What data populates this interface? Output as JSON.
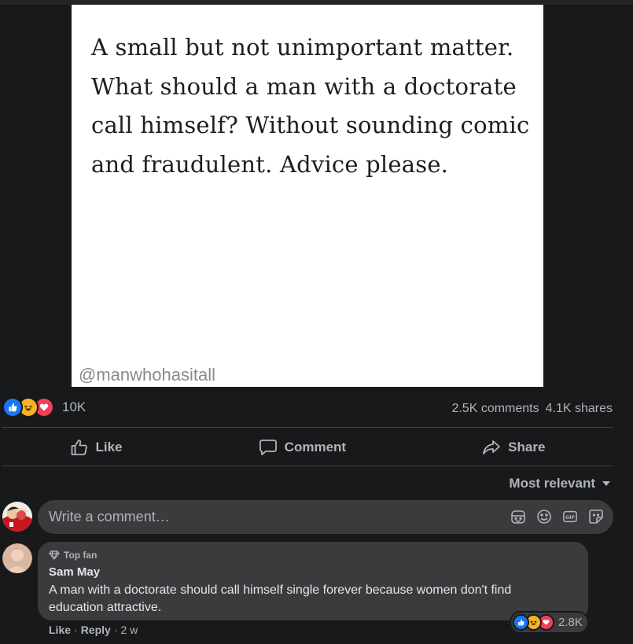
{
  "post": {
    "image_text": "A small but not unimportant matter. What should a man with a doctorate call himself? Without sounding comic and fraudulent. Advice please.",
    "watermark": "@manwhohasitall"
  },
  "reactions": {
    "types": [
      "like-icon",
      "haha-icon",
      "love-icon"
    ],
    "count": "10K"
  },
  "stats": {
    "comments": "2.5K comments",
    "shares": "4.1K shares"
  },
  "actions": {
    "like": "Like",
    "comment": "Comment",
    "share": "Share"
  },
  "sort": {
    "label": "Most relevant"
  },
  "composer": {
    "placeholder": "Write a comment…",
    "icons": [
      "sticker-face-icon",
      "emoji-icon",
      "gif-icon",
      "sticker-icon"
    ]
  },
  "comment": {
    "badge": "Top fan",
    "author": "Sam May",
    "text": "A man with a doctorate should call himself single forever because women don't find education attractive.",
    "like": "Like",
    "reply": "Reply",
    "time": "2 w",
    "reaction_count": "2.8K"
  },
  "colors": {
    "background": "#18191a",
    "surface": "#3a3b3c",
    "like_blue": "#1877f2",
    "love_red": "#f33e58",
    "haha_yellow": "#f7b125"
  }
}
